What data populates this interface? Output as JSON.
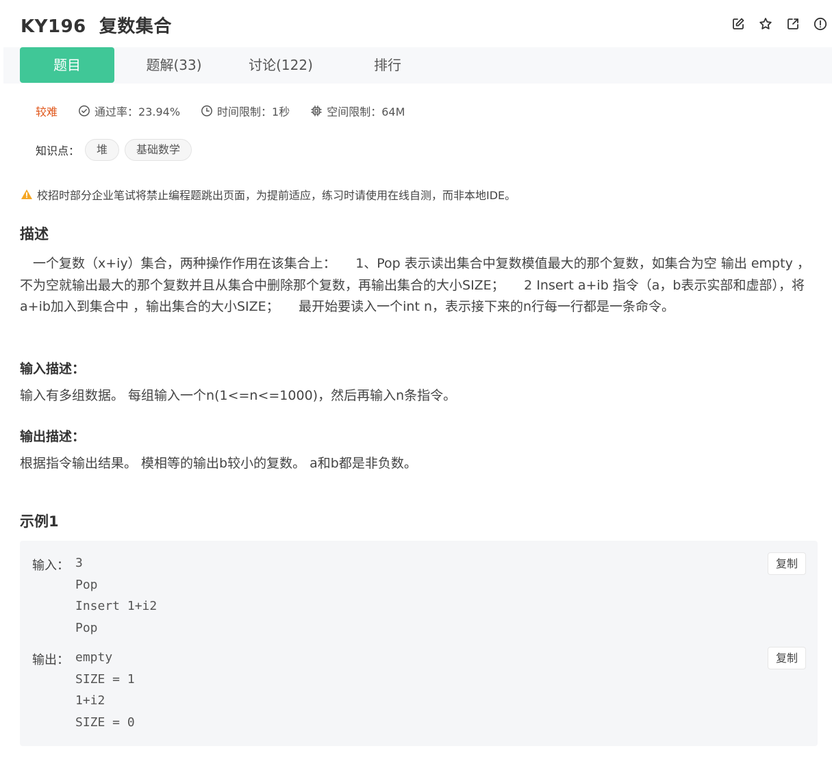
{
  "header": {
    "title": "KY196  复数集合",
    "icons": [
      "edit-icon",
      "star-icon",
      "external-link-icon",
      "info-icon"
    ]
  },
  "tabs": [
    {
      "label": "题目",
      "active": true
    },
    {
      "label": "题解(33)",
      "active": false
    },
    {
      "label": "讨论(122)",
      "active": false
    },
    {
      "label": "排行",
      "active": false
    }
  ],
  "meta": {
    "difficulty": "较难",
    "pass_rate": "通过率：23.94%",
    "time_limit": "时间限制：1秒",
    "memory_limit": "空间限制：64M"
  },
  "knowledge": {
    "label": "知识点：",
    "tags": [
      "堆",
      "基础数学"
    ]
  },
  "notice": "校招时部分企业笔试将禁止编程题跳出页面，为提前适应，练习时请使用在线自测，而非本地IDE。",
  "description": {
    "title": "描述",
    "text": "　一个复数（x+iy）集合，两种操作作用在该集合上：　　1、Pop 表示读出集合中复数模值最大的那个复数，如集合为空 输出  empty  ，不为空就输出最大的那个复数并且从集合中删除那个复数，再输出集合的大小SIZE；　　2 Insert a+ib  指令（a，b表示实部和虚部），将a+ib加入到集合中 ，输出集合的大小SIZE；　　最开始要读入一个int n，表示接下来的n行每一行都是一条命令。"
  },
  "input_desc": {
    "title": "输入描述：",
    "text": "输入有多组数据。 每组输入一个n(1<=n<=1000)，然后再输入n条指令。"
  },
  "output_desc": {
    "title": "输出描述：",
    "text": "根据指令输出结果。 模相等的输出b较小的复数。 a和b都是非负数。"
  },
  "example": {
    "title": "示例1",
    "input_label": "输入：",
    "input_lines": "3\nPop\nInsert 1+i2\nPop",
    "output_label": "输出：",
    "output_lines": "empty\nSIZE = 1\n1+i2\nSIZE = 0",
    "copy_label": "复制"
  },
  "colors": {
    "accent": "#40c797",
    "difficulty": "#e0571b",
    "warning": "#f5a623"
  }
}
